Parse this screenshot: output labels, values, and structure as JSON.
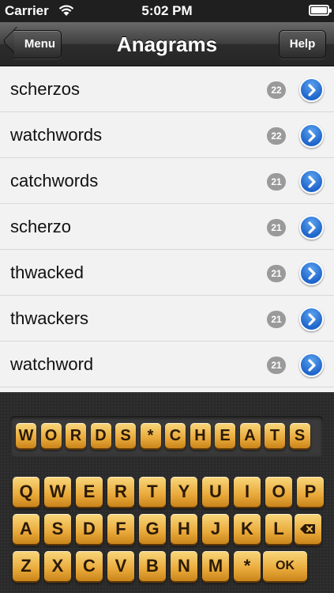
{
  "status_bar": {
    "carrier": "Carrier",
    "time": "5:02 PM"
  },
  "nav": {
    "title": "Anagrams",
    "left_button": "Menu",
    "right_button": "Help"
  },
  "list": [
    {
      "word": "scherzos",
      "score": "22"
    },
    {
      "word": "watchwords",
      "score": "22"
    },
    {
      "word": "catchwords",
      "score": "21"
    },
    {
      "word": "scherzo",
      "score": "21"
    },
    {
      "word": "thwacked",
      "score": "21"
    },
    {
      "word": "thwackers",
      "score": "21"
    },
    {
      "word": "watchword",
      "score": "21"
    }
  ],
  "input_tiles": [
    "W",
    "O",
    "R",
    "D",
    "S",
    "*",
    "C",
    "H",
    "E",
    "A",
    "T",
    "S"
  ],
  "keyboard": {
    "row1": [
      "Q",
      "W",
      "E",
      "R",
      "T",
      "Y",
      "U",
      "I",
      "O",
      "P"
    ],
    "row2": [
      "A",
      "S",
      "D",
      "F",
      "G",
      "H",
      "J",
      "K",
      "L"
    ],
    "row3": [
      "Z",
      "X",
      "C",
      "V",
      "B",
      "N",
      "M",
      "*"
    ],
    "ok_label": "OK",
    "delete_icon": "backspace-icon"
  },
  "colors": {
    "tile": "#e9a93a",
    "disclosure": "#1f66cc",
    "badge": "#9a9a9a"
  }
}
